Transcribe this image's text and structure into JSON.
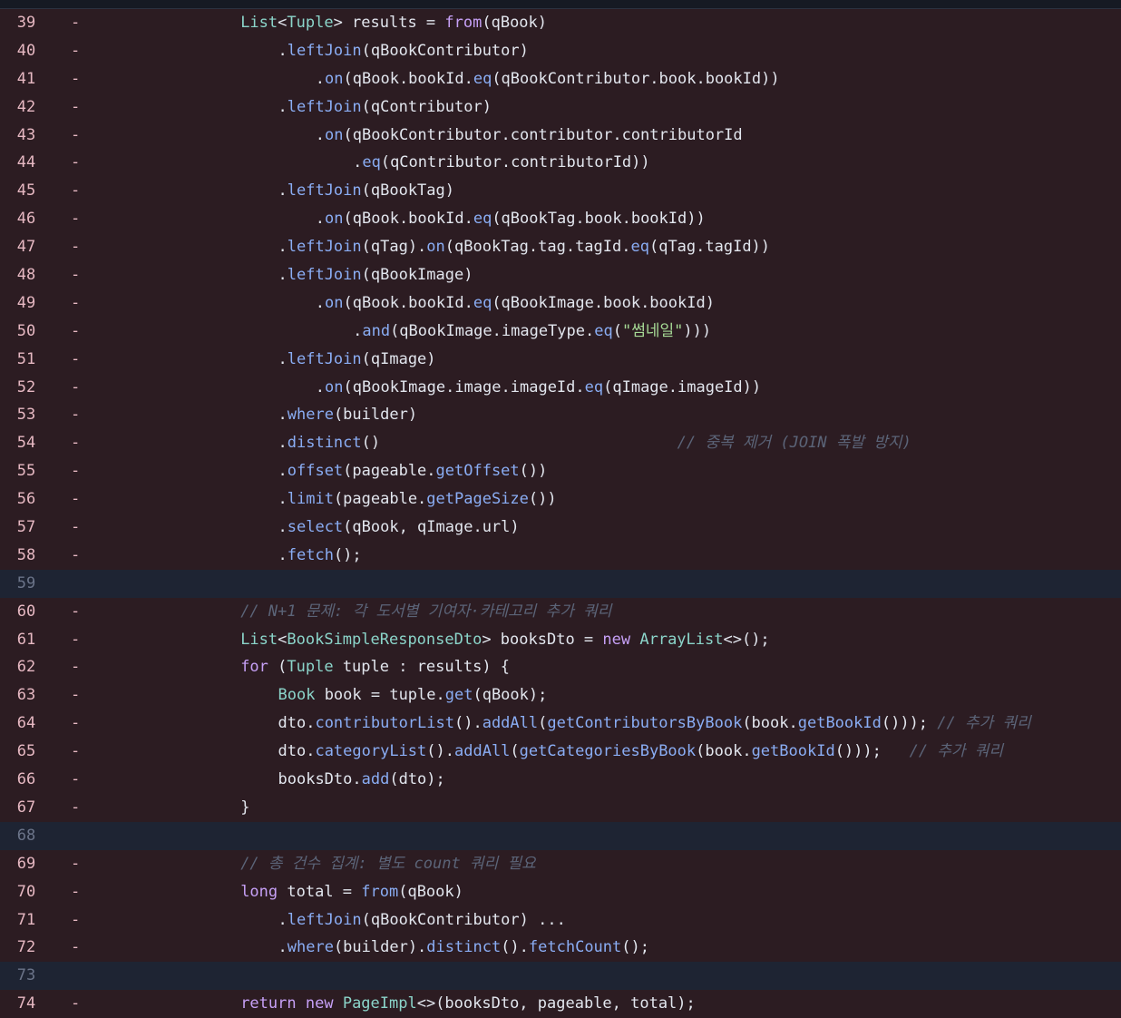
{
  "colors": {
    "background": "#1b1f2a",
    "deleted_line": "#2c1c22",
    "context_line": "#1e2433",
    "keyword": "#c6a0f6",
    "type": "#8bd5ca",
    "method": "#8aadf4",
    "string": "#a6da95",
    "comment": "#5b6478"
  },
  "lines": [
    {
      "num": "39",
      "kind": "del",
      "marker": "-",
      "indent": 4,
      "tokens": [
        [
          "ty",
          "List"
        ],
        [
          "pl",
          "<"
        ],
        [
          "ty",
          "Tuple"
        ],
        [
          "pl",
          "> results = "
        ],
        [
          "kw",
          "from"
        ],
        [
          "pl",
          "(qBook)"
        ]
      ]
    },
    {
      "num": "40",
      "kind": "del",
      "marker": "-",
      "indent": 5,
      "tokens": [
        [
          "pl",
          "."
        ],
        [
          "fn",
          "leftJoin"
        ],
        [
          "pl",
          "(qBookContributor)"
        ]
      ]
    },
    {
      "num": "41",
      "kind": "del",
      "marker": "-",
      "indent": 6,
      "tokens": [
        [
          "pl",
          "."
        ],
        [
          "fn",
          "on"
        ],
        [
          "pl",
          "(qBook.bookId."
        ],
        [
          "fn",
          "eq"
        ],
        [
          "pl",
          "(qBookContributor.book.bookId))"
        ]
      ]
    },
    {
      "num": "42",
      "kind": "del",
      "marker": "-",
      "indent": 5,
      "tokens": [
        [
          "pl",
          "."
        ],
        [
          "fn",
          "leftJoin"
        ],
        [
          "pl",
          "(qContributor)"
        ]
      ]
    },
    {
      "num": "43",
      "kind": "del",
      "marker": "-",
      "indent": 6,
      "tokens": [
        [
          "pl",
          "."
        ],
        [
          "fn",
          "on"
        ],
        [
          "pl",
          "(qBookContributor.contributor.contributorId"
        ]
      ]
    },
    {
      "num": "44",
      "kind": "del",
      "marker": "-",
      "indent": 7,
      "tokens": [
        [
          "pl",
          "."
        ],
        [
          "fn",
          "eq"
        ],
        [
          "pl",
          "(qContributor.contributorId))"
        ]
      ]
    },
    {
      "num": "45",
      "kind": "del",
      "marker": "-",
      "indent": 5,
      "tokens": [
        [
          "pl",
          "."
        ],
        [
          "fn",
          "leftJoin"
        ],
        [
          "pl",
          "(qBookTag)"
        ]
      ]
    },
    {
      "num": "46",
      "kind": "del",
      "marker": "-",
      "indent": 6,
      "tokens": [
        [
          "pl",
          "."
        ],
        [
          "fn",
          "on"
        ],
        [
          "pl",
          "(qBook.bookId."
        ],
        [
          "fn",
          "eq"
        ],
        [
          "pl",
          "(qBookTag.book.bookId))"
        ]
      ]
    },
    {
      "num": "47",
      "kind": "del",
      "marker": "-",
      "indent": 5,
      "tokens": [
        [
          "pl",
          "."
        ],
        [
          "fn",
          "leftJoin"
        ],
        [
          "pl",
          "(qTag)."
        ],
        [
          "fn",
          "on"
        ],
        [
          "pl",
          "(qBookTag.tag.tagId."
        ],
        [
          "fn",
          "eq"
        ],
        [
          "pl",
          "(qTag.tagId))"
        ]
      ]
    },
    {
      "num": "48",
      "kind": "del",
      "marker": "-",
      "indent": 5,
      "tokens": [
        [
          "pl",
          "."
        ],
        [
          "fn",
          "leftJoin"
        ],
        [
          "pl",
          "(qBookImage)"
        ]
      ]
    },
    {
      "num": "49",
      "kind": "del",
      "marker": "-",
      "indent": 6,
      "tokens": [
        [
          "pl",
          "."
        ],
        [
          "fn",
          "on"
        ],
        [
          "pl",
          "(qBook.bookId."
        ],
        [
          "fn",
          "eq"
        ],
        [
          "pl",
          "(qBookImage.book.bookId)"
        ]
      ]
    },
    {
      "num": "50",
      "kind": "del",
      "marker": "-",
      "indent": 7,
      "tokens": [
        [
          "pl",
          "."
        ],
        [
          "fn",
          "and"
        ],
        [
          "pl",
          "(qBookImage.imageType."
        ],
        [
          "fn",
          "eq"
        ],
        [
          "pl",
          "("
        ],
        [
          "st",
          "\"썸네일\""
        ],
        [
          "pl",
          ")))"
        ]
      ]
    },
    {
      "num": "51",
      "kind": "del",
      "marker": "-",
      "indent": 5,
      "tokens": [
        [
          "pl",
          "."
        ],
        [
          "fn",
          "leftJoin"
        ],
        [
          "pl",
          "(qImage)"
        ]
      ]
    },
    {
      "num": "52",
      "kind": "del",
      "marker": "-",
      "indent": 6,
      "tokens": [
        [
          "pl",
          "."
        ],
        [
          "fn",
          "on"
        ],
        [
          "pl",
          "(qBookImage.image.imageId."
        ],
        [
          "fn",
          "eq"
        ],
        [
          "pl",
          "(qImage.imageId))"
        ]
      ]
    },
    {
      "num": "53",
      "kind": "del",
      "marker": "-",
      "indent": 5,
      "tokens": [
        [
          "pl",
          "."
        ],
        [
          "fn",
          "where"
        ],
        [
          "pl",
          "(builder)"
        ]
      ]
    },
    {
      "num": "54",
      "kind": "del",
      "marker": "-",
      "indent": 5,
      "tokens": [
        [
          "pl",
          "."
        ],
        [
          "fn",
          "distinct"
        ],
        [
          "pl",
          "()                                "
        ],
        [
          "cm",
          "// 중복 제거 (JOIN 폭발 방지)"
        ]
      ]
    },
    {
      "num": "55",
      "kind": "del",
      "marker": "-",
      "indent": 5,
      "tokens": [
        [
          "pl",
          "."
        ],
        [
          "fn",
          "offset"
        ],
        [
          "pl",
          "(pageable."
        ],
        [
          "fn",
          "getOffset"
        ],
        [
          "pl",
          "())"
        ]
      ]
    },
    {
      "num": "56",
      "kind": "del",
      "marker": "-",
      "indent": 5,
      "tokens": [
        [
          "pl",
          "."
        ],
        [
          "fn",
          "limit"
        ],
        [
          "pl",
          "(pageable."
        ],
        [
          "fn",
          "getPageSize"
        ],
        [
          "pl",
          "())"
        ]
      ]
    },
    {
      "num": "57",
      "kind": "del",
      "marker": "-",
      "indent": 5,
      "tokens": [
        [
          "pl",
          "."
        ],
        [
          "fn",
          "select"
        ],
        [
          "pl",
          "(qBook, qImage.url)"
        ]
      ]
    },
    {
      "num": "58",
      "kind": "del",
      "marker": "-",
      "indent": 5,
      "tokens": [
        [
          "pl",
          "."
        ],
        [
          "fn",
          "fetch"
        ],
        [
          "pl",
          "();"
        ]
      ]
    },
    {
      "num": "59",
      "kind": "ctx",
      "marker": "",
      "indent": 0,
      "tokens": []
    },
    {
      "num": "60",
      "kind": "del",
      "marker": "-",
      "indent": 4,
      "tokens": [
        [
          "cm",
          "// N+1 문제: 각 도서별 기여자·카테고리 추가 쿼리"
        ]
      ]
    },
    {
      "num": "61",
      "kind": "del",
      "marker": "-",
      "indent": 4,
      "tokens": [
        [
          "ty",
          "List"
        ],
        [
          "pl",
          "<"
        ],
        [
          "ty",
          "BookSimpleResponseDto"
        ],
        [
          "pl",
          "> booksDto = "
        ],
        [
          "kw",
          "new"
        ],
        [
          "pl",
          " "
        ],
        [
          "ty",
          "ArrayList"
        ],
        [
          "pl",
          "<>();"
        ]
      ]
    },
    {
      "num": "62",
      "kind": "del",
      "marker": "-",
      "indent": 4,
      "tokens": [
        [
          "kw",
          "for"
        ],
        [
          "pl",
          " ("
        ],
        [
          "ty",
          "Tuple"
        ],
        [
          "pl",
          " tuple : results) {"
        ]
      ]
    },
    {
      "num": "63",
      "kind": "del",
      "marker": "-",
      "indent": 5,
      "tokens": [
        [
          "ty",
          "Book"
        ],
        [
          "pl",
          " book = tuple."
        ],
        [
          "fn",
          "get"
        ],
        [
          "pl",
          "(qBook);"
        ]
      ]
    },
    {
      "num": "64",
      "kind": "del",
      "marker": "-",
      "indent": 5,
      "tokens": [
        [
          "pl",
          "dto."
        ],
        [
          "fn",
          "contributorList"
        ],
        [
          "pl",
          "()."
        ],
        [
          "fn",
          "addAll"
        ],
        [
          "pl",
          "("
        ],
        [
          "fn",
          "getContributorsByBook"
        ],
        [
          "pl",
          "(book."
        ],
        [
          "fn",
          "getBookId"
        ],
        [
          "pl",
          "())); "
        ],
        [
          "cm",
          "// 추가 쿼리"
        ]
      ]
    },
    {
      "num": "65",
      "kind": "del",
      "marker": "-",
      "indent": 5,
      "tokens": [
        [
          "pl",
          "dto."
        ],
        [
          "fn",
          "categoryList"
        ],
        [
          "pl",
          "()."
        ],
        [
          "fn",
          "addAll"
        ],
        [
          "pl",
          "("
        ],
        [
          "fn",
          "getCategoriesByBook"
        ],
        [
          "pl",
          "(book."
        ],
        [
          "fn",
          "getBookId"
        ],
        [
          "pl",
          "()));   "
        ],
        [
          "cm",
          "// 추가 쿼리"
        ]
      ]
    },
    {
      "num": "66",
      "kind": "del",
      "marker": "-",
      "indent": 5,
      "tokens": [
        [
          "pl",
          "booksDto."
        ],
        [
          "fn",
          "add"
        ],
        [
          "pl",
          "(dto);"
        ]
      ]
    },
    {
      "num": "67",
      "kind": "del",
      "marker": "-",
      "indent": 4,
      "tokens": [
        [
          "pl",
          "}"
        ]
      ]
    },
    {
      "num": "68",
      "kind": "ctx",
      "marker": "",
      "indent": 0,
      "tokens": []
    },
    {
      "num": "69",
      "kind": "del",
      "marker": "-",
      "indent": 4,
      "tokens": [
        [
          "cm",
          "// 총 건수 집계: 별도 count 쿼리 필요"
        ]
      ]
    },
    {
      "num": "70",
      "kind": "del",
      "marker": "-",
      "indent": 4,
      "tokens": [
        [
          "kw",
          "long"
        ],
        [
          "pl",
          " total = "
        ],
        [
          "fn",
          "from"
        ],
        [
          "pl",
          "(qBook)"
        ]
      ]
    },
    {
      "num": "71",
      "kind": "del",
      "marker": "-",
      "indent": 5,
      "tokens": [
        [
          "pl",
          "."
        ],
        [
          "fn",
          "leftJoin"
        ],
        [
          "pl",
          "(qBookContributor) ..."
        ]
      ]
    },
    {
      "num": "72",
      "kind": "del",
      "marker": "-",
      "indent": 5,
      "tokens": [
        [
          "pl",
          "."
        ],
        [
          "fn",
          "where"
        ],
        [
          "pl",
          "(builder)."
        ],
        [
          "fn",
          "distinct"
        ],
        [
          "pl",
          "()."
        ],
        [
          "fn",
          "fetchCount"
        ],
        [
          "pl",
          "();"
        ]
      ]
    },
    {
      "num": "73",
      "kind": "ctx",
      "marker": "",
      "indent": 0,
      "tokens": []
    },
    {
      "num": "74",
      "kind": "del",
      "marker": "-",
      "indent": 4,
      "tokens": [
        [
          "kw",
          "return"
        ],
        [
          "pl",
          " "
        ],
        [
          "kw",
          "new"
        ],
        [
          "pl",
          " "
        ],
        [
          "ty",
          "PageImpl"
        ],
        [
          "pl",
          "<>(booksDto, pageable, total);"
        ]
      ]
    }
  ]
}
